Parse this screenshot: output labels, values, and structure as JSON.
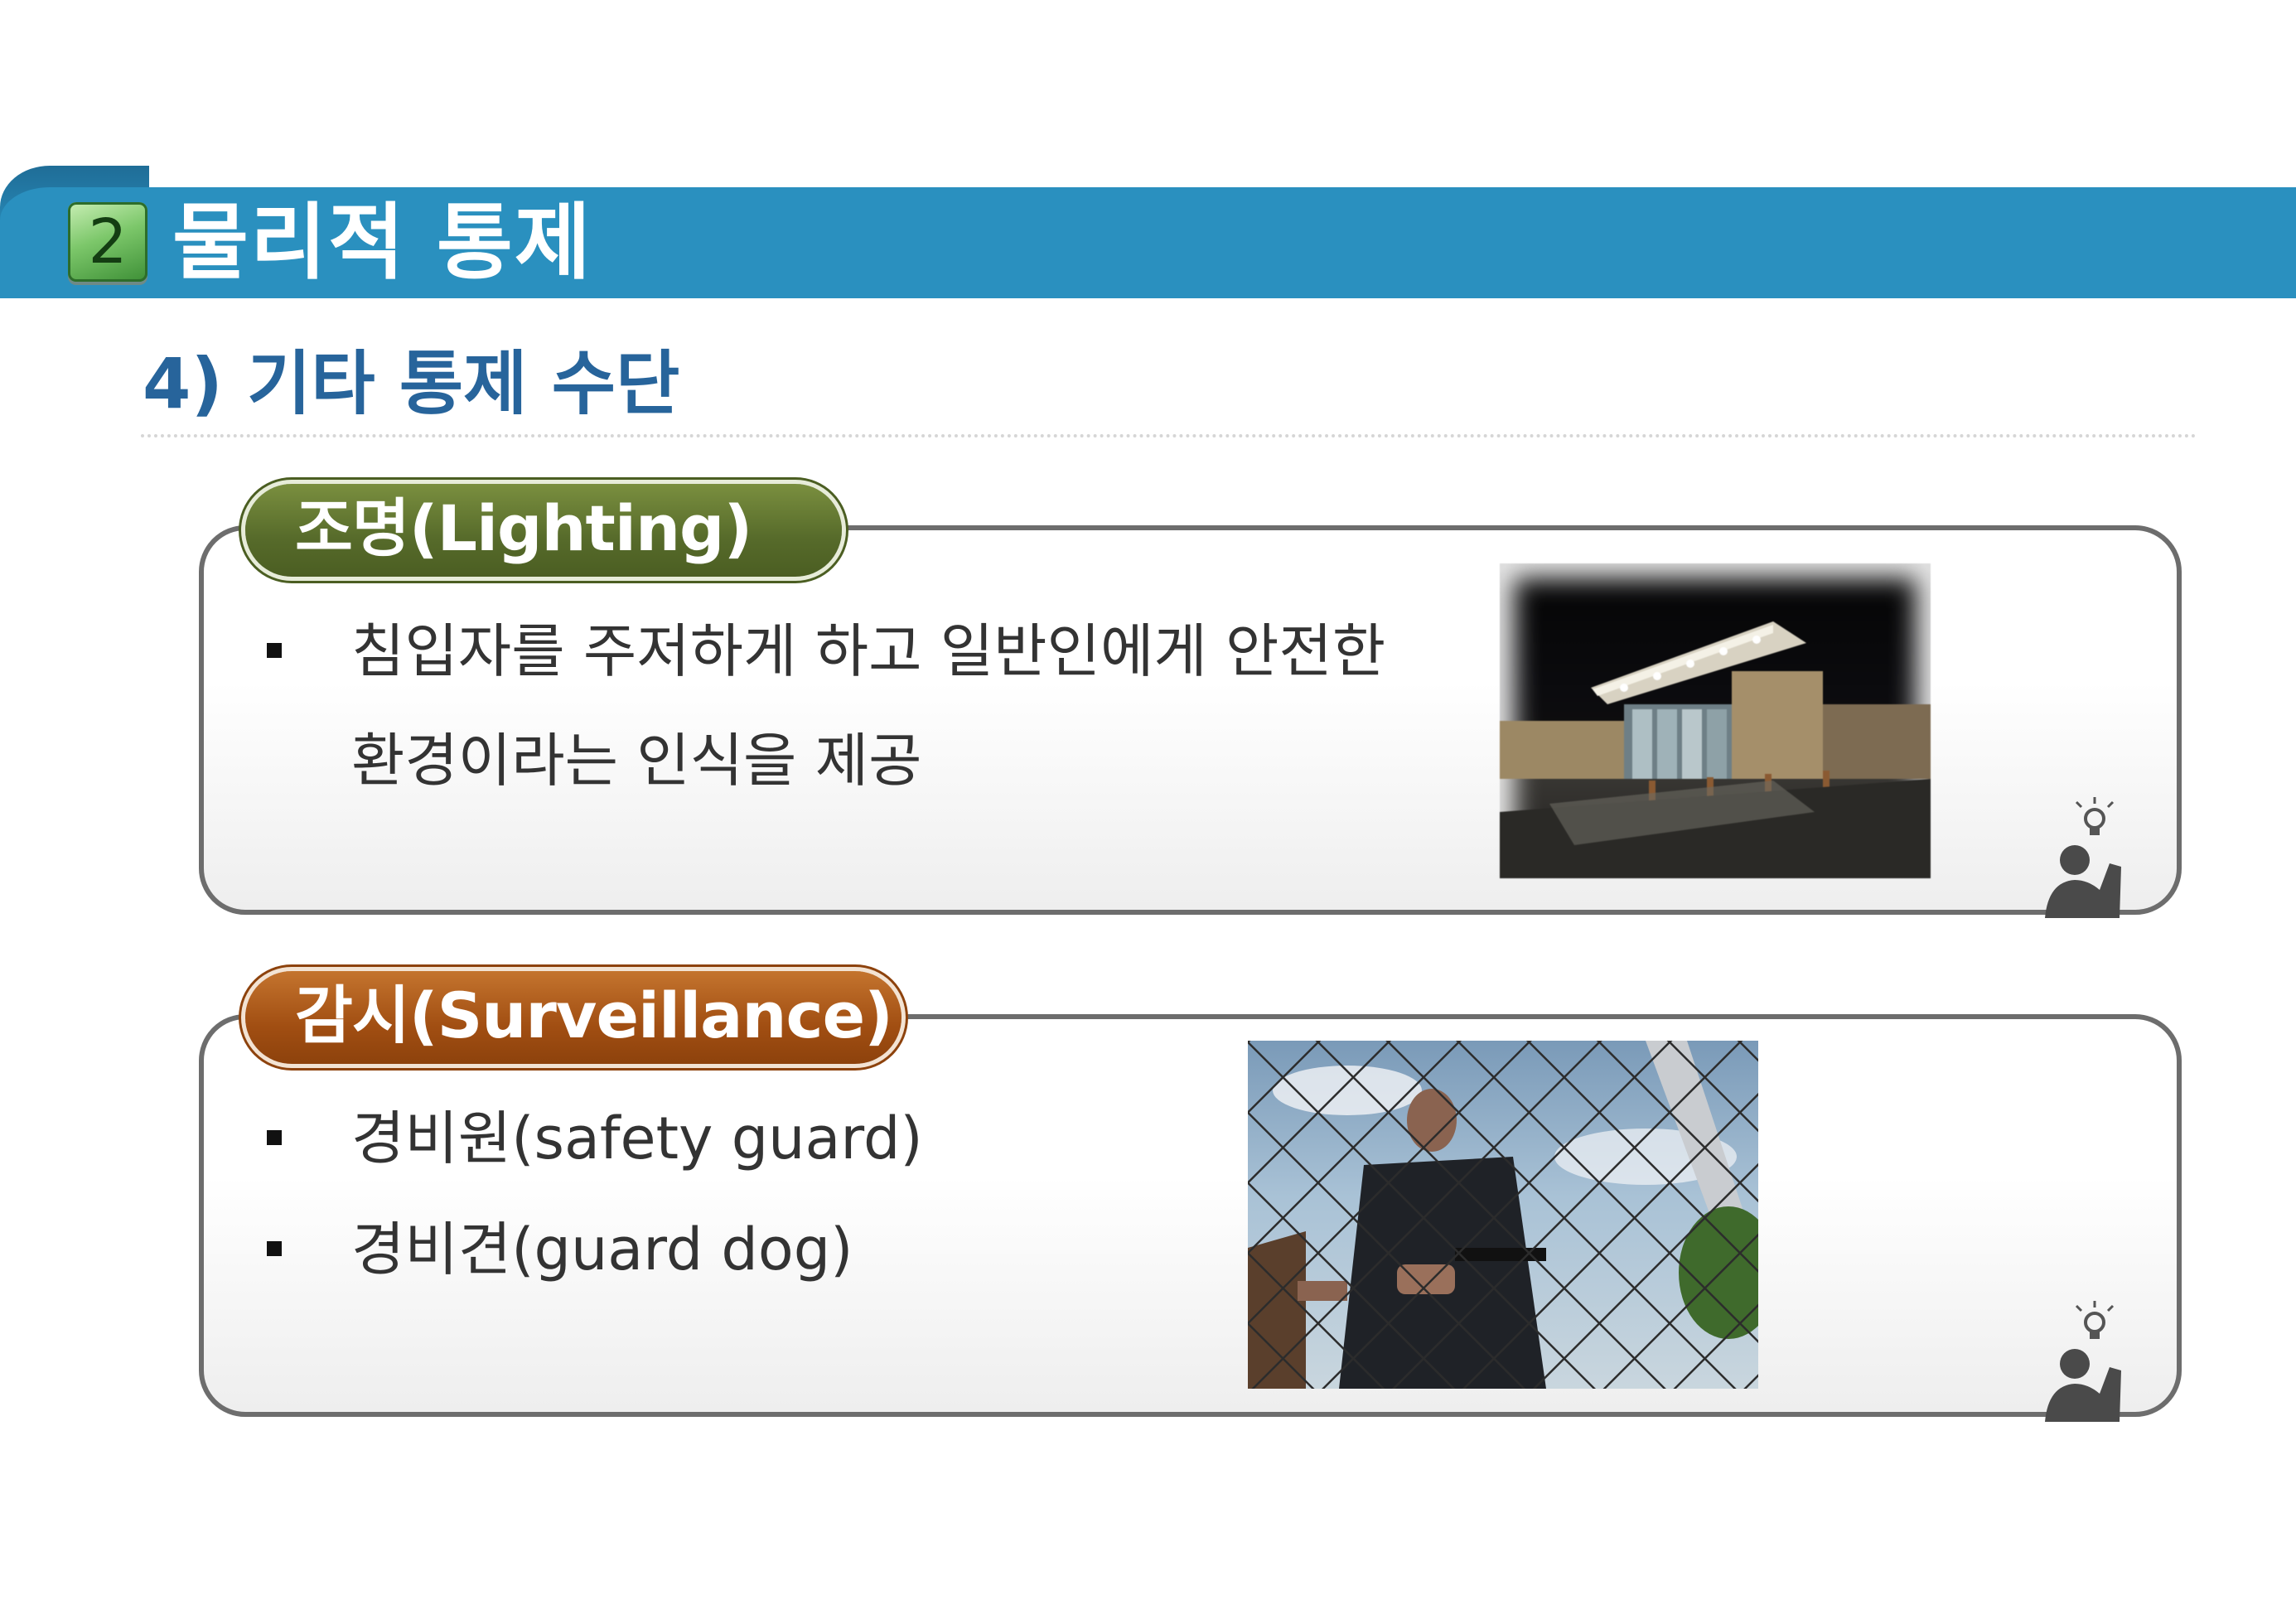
{
  "header": {
    "section_number": "2",
    "section_title": "물리적 통제"
  },
  "subtitle": "4) 기타 통제 수단",
  "cards": [
    {
      "label": "조명(Lighting)",
      "bullets": [
        "침입자를 주저하게 하고 일반인에게 안전한",
        "환경이라는 인식을 제공"
      ]
    },
    {
      "label": "감시(Surveillance)",
      "bullets": [
        "경비원(safety guard)",
        "경비견(guard dog)"
      ]
    }
  ],
  "colors": {
    "banner": "#2a90bf",
    "subtitle": "#27649b",
    "pill_lighting": "#566a2a",
    "pill_surveillance": "#a14e12",
    "card_border": "#6d6d6d"
  },
  "icons": [
    "person-idea-icon",
    "lightbulb-icon"
  ]
}
